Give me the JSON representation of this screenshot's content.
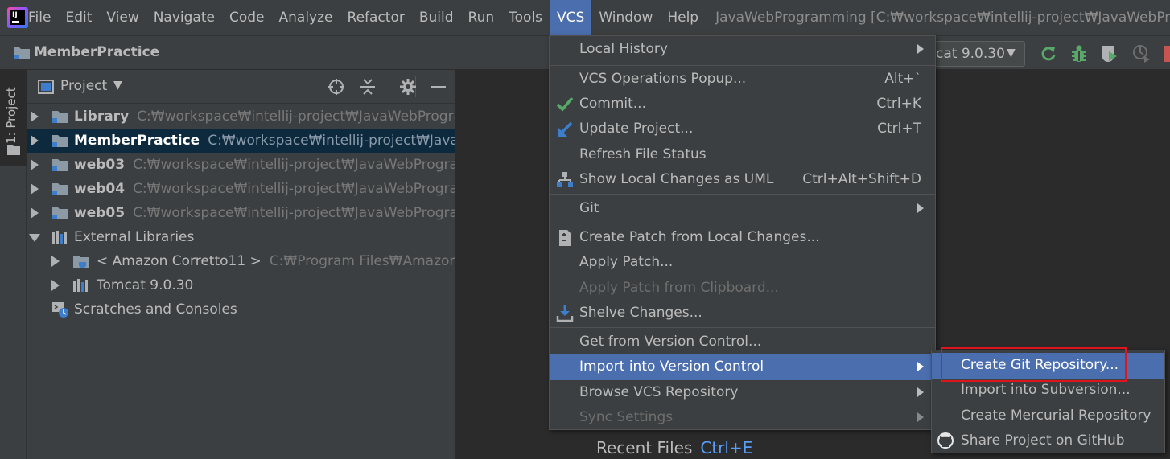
{
  "menubar": {
    "items": [
      "File",
      "Edit",
      "View",
      "Navigate",
      "Code",
      "Analyze",
      "Refactor",
      "Build",
      "Run",
      "Tools",
      "VCS",
      "Window",
      "Help"
    ],
    "active": "VCS",
    "window_title": "JavaWebProgramming [C:₩workspace₩intellij-project₩JavaWebProgra"
  },
  "navbar": {
    "title": "MemberPractice",
    "run_config": "cat 9.0.30"
  },
  "side_stripe": {
    "project_tab": "1: Project"
  },
  "project_panel": {
    "title": "Project",
    "rows": [
      {
        "name": "Library",
        "path": "C:₩workspace₩intellij-project₩JavaWebProgramm"
      },
      {
        "name": "MemberPractice",
        "path": "C:₩workspace₩intellij-project₩JavaWeb"
      },
      {
        "name": "web03",
        "path": "C:₩workspace₩intellij-project₩JavaWebProgramm"
      },
      {
        "name": "web04",
        "path": "C:₩workspace₩intellij-project₩JavaWebProgramm"
      },
      {
        "name": "web05",
        "path": "C:₩workspace₩intellij-project₩JavaWebProgramm"
      },
      {
        "name": "External Libraries",
        "path": ""
      },
      {
        "name": "< Amazon Corretto11 >",
        "path": "C:₩Program Files₩Amazon Co"
      },
      {
        "name": "Tomcat 9.0.30",
        "path": ""
      },
      {
        "name": "Scratches and Consoles",
        "path": ""
      }
    ]
  },
  "vcs_menu": {
    "local_history": "Local History",
    "operations_popup": "VCS Operations Popup...",
    "operations_popup_shortcut": "Alt+`",
    "commit": "Commit...",
    "commit_shortcut": "Ctrl+K",
    "update_project": "Update Project...",
    "update_project_shortcut": "Ctrl+T",
    "refresh_status": "Refresh File Status",
    "show_uml": "Show Local Changes as UML",
    "show_uml_shortcut": "Ctrl+Alt+Shift+D",
    "git": "Git",
    "create_patch": "Create Patch from Local Changes...",
    "apply_patch": "Apply Patch...",
    "apply_patch_clipboard": "Apply Patch from Clipboard...",
    "shelve_changes": "Shelve Changes...",
    "get_from_vc": "Get from Version Control...",
    "import_into_vc": "Import into Version Control",
    "browse_repo": "Browse VCS Repository",
    "sync_settings": "Sync Settings"
  },
  "submenu": {
    "create_git": "Create Git Repository...",
    "import_svn": "Import into Subversion...",
    "create_hg": "Create Mercurial Repository",
    "share_github": "Share Project on GitHub"
  },
  "editor": {
    "recent_files": "Recent Files",
    "recent_files_shortcut": "Ctrl+E"
  },
  "colors": {
    "accent": "#4b6eaf",
    "highlight_box": "#e0141e",
    "selection": "#0d293e"
  }
}
